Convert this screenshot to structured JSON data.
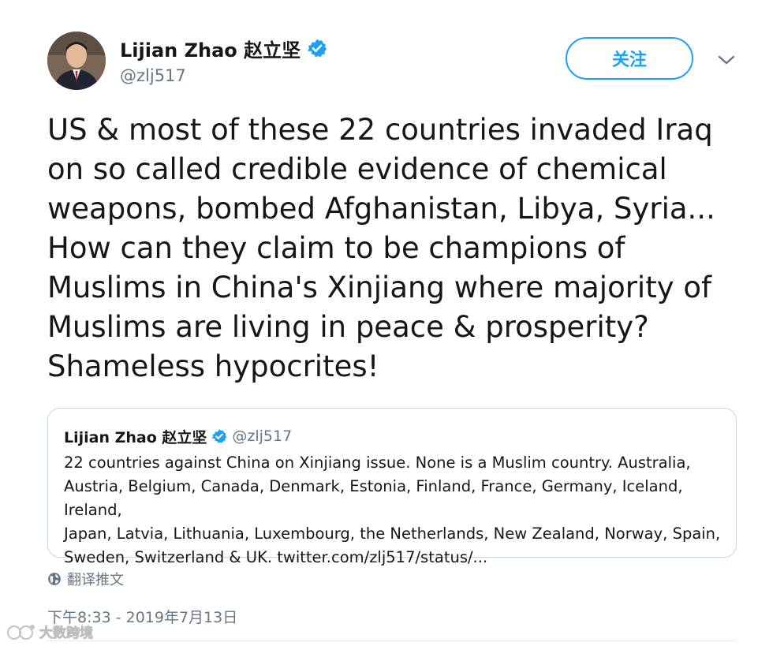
{
  "author": {
    "display_name": "Lijian Zhao 赵立坚",
    "handle": "@zlj517"
  },
  "follow_button": {
    "label": "关注"
  },
  "tweet": {
    "text": "US & most of these 22 countries invaded Iraq\non so called credible evidence of chemical\nweapons, bombed Afghanistan, Libya, Syria...\nHow can they claim to be champions of\nMuslims in China's Xinjiang where majority of\nMuslims are living in peace & prosperity?\nShameless hypocrites!"
  },
  "quoted_tweet": {
    "display_name": "Lijian Zhao 赵立坚",
    "handle": "@zlj517",
    "text": "22 countries against China on Xinjiang issue. None is a Muslim country. Australia,\nAustria, Belgium, Canada, Denmark, Estonia, Finland, France, Germany, Iceland, Ireland,\nJapan, Latvia, Lithuania, Luxembourg, the Netherlands, New Zealand, Norway, Spain,\nSweden, Switzerland & UK. twitter.com/zlj517/status/..."
  },
  "translate": {
    "label": "翻译推文",
    "icon": "globe-icon"
  },
  "timestamp": "下午8:33 - 2019年7月13日",
  "watermark": {
    "text": "大数跨境"
  },
  "colors": {
    "accent": "#1da1f2",
    "secondary_text": "#657786",
    "border": "#ccd6dd"
  }
}
